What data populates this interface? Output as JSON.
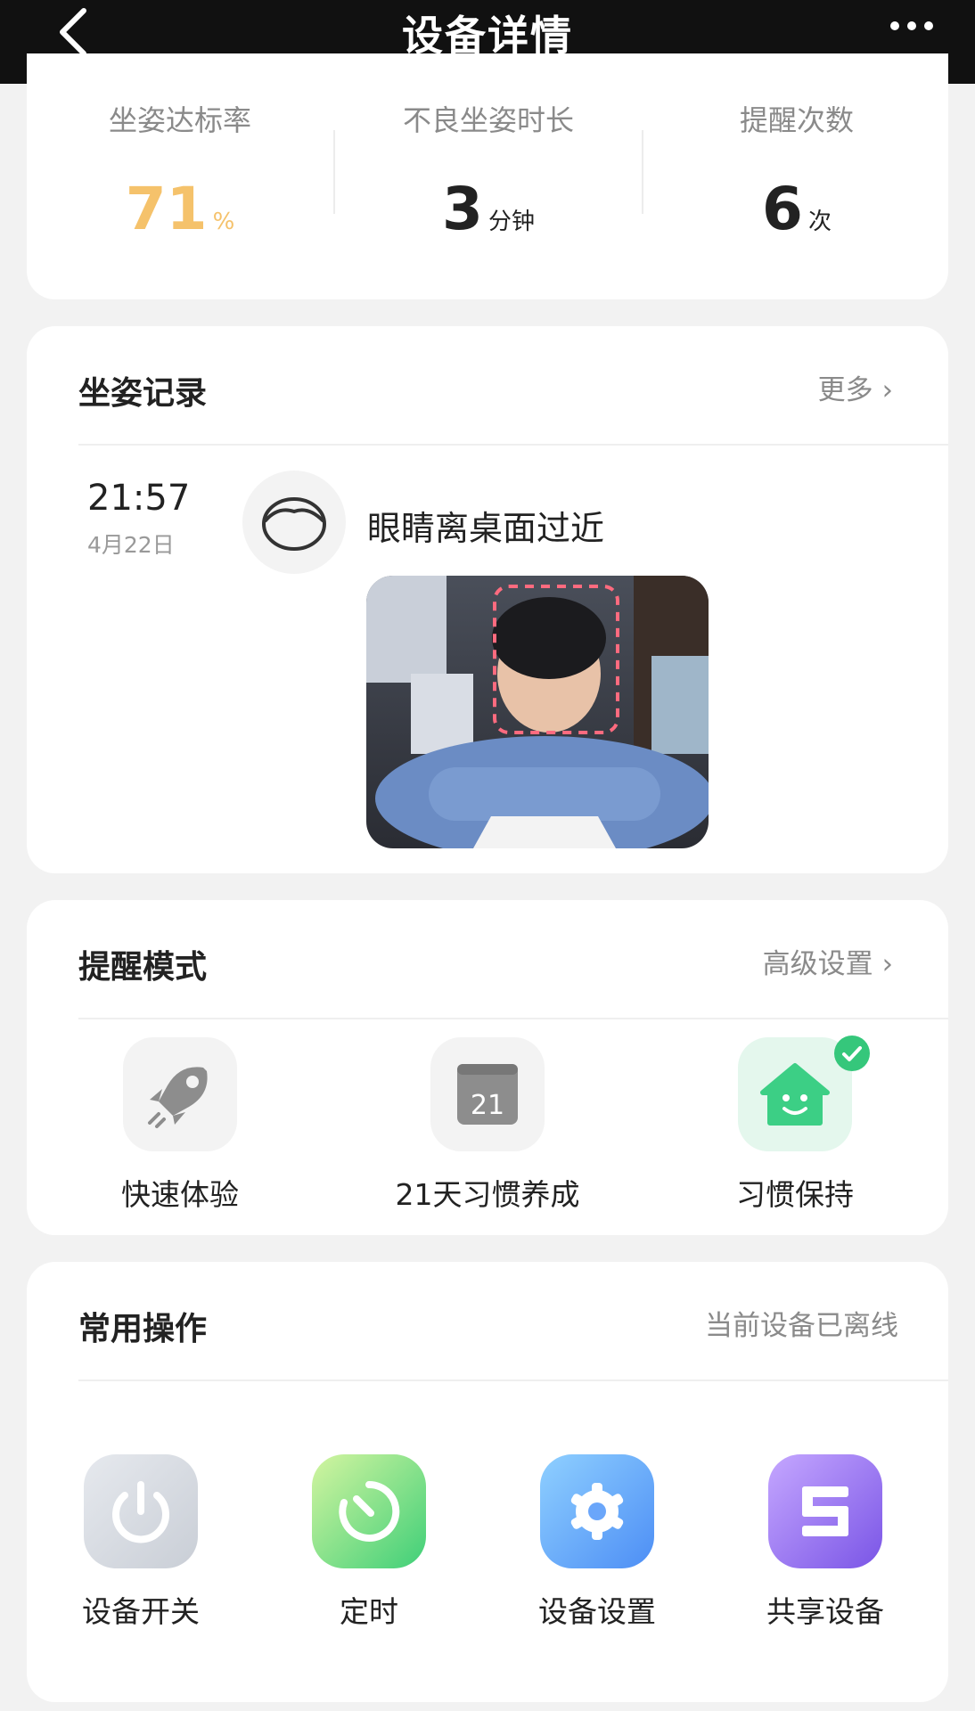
{
  "header": {
    "title": "设备详情",
    "back_icon": "chevron-left-icon",
    "more_icon": "more-dots-icon"
  },
  "stats": [
    {
      "label": "坐姿达标率",
      "value": "71",
      "unit": "%",
      "color": "#f5c26b"
    },
    {
      "label": "不良坐姿时长",
      "value": "3",
      "unit": "分钟"
    },
    {
      "label": "提醒次数",
      "value": "6",
      "unit": "次"
    }
  ],
  "record": {
    "title": "坐姿记录",
    "more": "更多",
    "item": {
      "time": "21:57",
      "date": "4月22日",
      "icon": "face-icon",
      "text": "眼睛离桌面过近"
    }
  },
  "remind": {
    "title": "提醒模式",
    "link": "高级设置",
    "modes": [
      {
        "label": "快速体验",
        "icon": "rocket-icon"
      },
      {
        "label": "21天习惯养成",
        "icon": "calendar-icon",
        "calendar_day": "21"
      },
      {
        "label": "习惯保持",
        "icon": "house-smile-icon",
        "selected": true
      }
    ]
  },
  "ops": {
    "title": "常用操作",
    "status": "当前设备已离线",
    "items": [
      {
        "label": "设备开关",
        "icon": "power-icon"
      },
      {
        "label": "定时",
        "icon": "timer-icon"
      },
      {
        "label": "设备设置",
        "icon": "gear-icon"
      },
      {
        "label": "共享设备",
        "icon": "share-icon"
      }
    ]
  },
  "colors": {
    "accent_orange": "#f5c26b",
    "check_green": "#35c77b",
    "top_bar": "#111111"
  }
}
